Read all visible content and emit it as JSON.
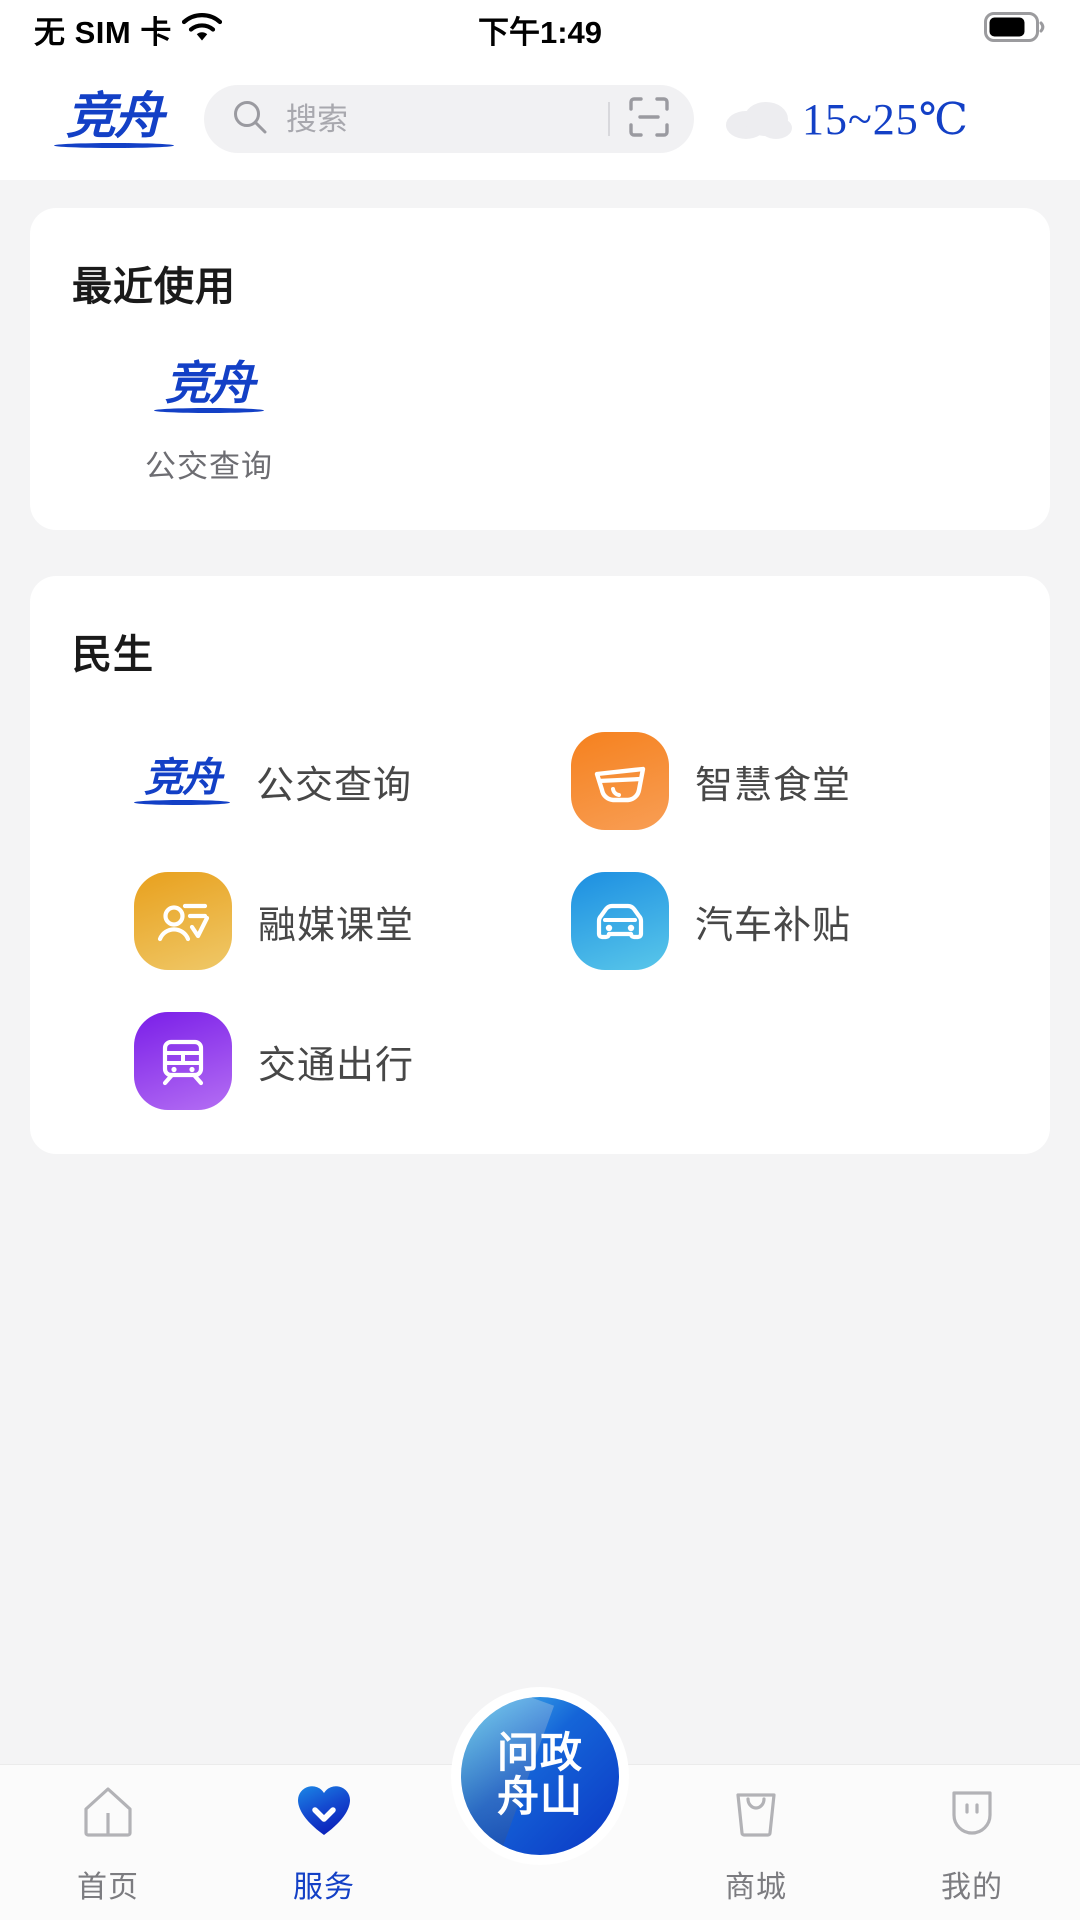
{
  "status_bar": {
    "carrier": "无 SIM 卡",
    "time": "下午1:49",
    "wifi_icon": "wifi-icon",
    "battery_icon": "battery-icon",
    "battery_level_percent": 70
  },
  "header": {
    "logo_text": "竞舟",
    "search": {
      "placeholder": "搜索",
      "value": "",
      "search_icon": "search-icon",
      "scan_icon": "scan-qr-icon"
    },
    "weather": {
      "icon": "cloud-icon",
      "temperature": "15~25℃"
    }
  },
  "colors": {
    "brand_blue": "#1340c6",
    "page_background": "#f4f4f5",
    "card_background": "#ffffff",
    "label_gray": "#6d6d72",
    "active_tab": "#1340c6"
  },
  "sections": [
    {
      "id": "recent",
      "title": "最近使用",
      "items": [
        {
          "label": "公交查询",
          "icon": "jingzhou-logo-icon",
          "icon_type": "logo"
        }
      ]
    },
    {
      "id": "livelihood",
      "title": "民生",
      "items": [
        {
          "label": "公交查询",
          "icon": "jingzhou-logo-icon",
          "icon_type": "logo"
        },
        {
          "label": "智慧食堂",
          "icon": "bowl-icon",
          "icon_type": "tile",
          "color_from": "#f58020",
          "color_to": "#f79a50"
        },
        {
          "label": "融媒课堂",
          "icon": "person-card-icon",
          "icon_type": "tile",
          "color_from": "#e9a321",
          "color_to": "#eec363"
        },
        {
          "label": "汽车补贴",
          "icon": "car-icon",
          "icon_type": "tile",
          "color_from": "#1f8fe0",
          "color_to": "#55c3e8"
        },
        {
          "label": "交通出行",
          "icon": "train-icon",
          "icon_type": "tile",
          "color_from": "#7a22e8",
          "color_to": "#b06bf2"
        }
      ]
    }
  ],
  "tabbar": {
    "items": [
      {
        "label": "首页",
        "icon": "home-icon",
        "active": false
      },
      {
        "label": "服务",
        "icon": "heart-check-icon",
        "active": true
      },
      {
        "label": "",
        "icon": "wenzheng-zhoushan-icon",
        "active": false,
        "center": true
      },
      {
        "label": "商城",
        "icon": "shopping-bag-icon",
        "active": false
      },
      {
        "label": "我的",
        "icon": "profile-icon",
        "active": false
      }
    ],
    "center_button_text": "问政\n舟山"
  }
}
